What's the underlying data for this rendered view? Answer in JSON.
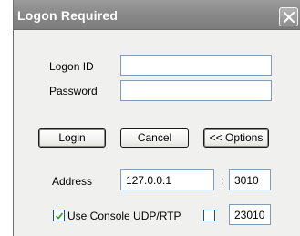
{
  "window": {
    "title": "Logon Required"
  },
  "form": {
    "logon_id_label": "Logon ID",
    "logon_id_value": "",
    "password_label": "Password",
    "password_value": ""
  },
  "buttons": {
    "login_label": "Login",
    "cancel_label": "Cancel",
    "options_label": "<< Options"
  },
  "options": {
    "address_label": "Address",
    "address_value": "127.0.0.1",
    "port_separator": ":",
    "port_value": "3010",
    "use_console_label": "Use Console UDP/RTP",
    "use_console_checked": true,
    "udp_checked": false,
    "udp_port_value": "23010"
  },
  "icons": {
    "close": "close-icon",
    "check": "checkmark-icon"
  }
}
